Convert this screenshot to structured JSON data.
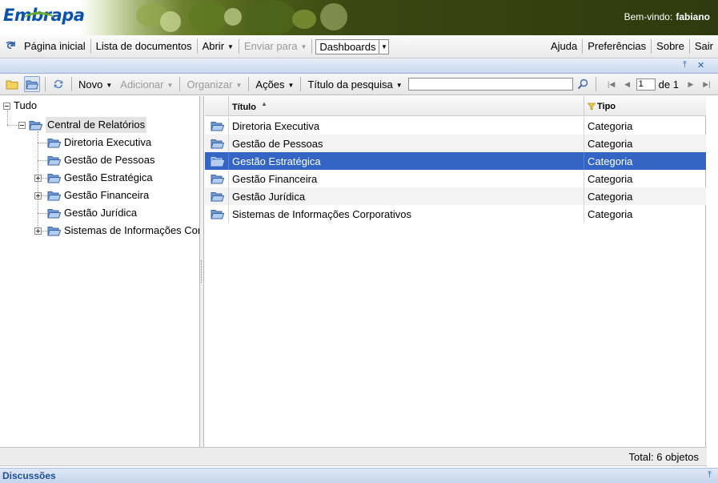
{
  "header": {
    "logo_text": "Embrapa",
    "welcome_label": "Bem-vindo:",
    "username": "fabiano"
  },
  "nav": {
    "home": "Página inicial",
    "documents": "Lista de documentos",
    "open": "Abrir",
    "send_to": "Enviar para",
    "dashboards": "Dashboards",
    "help": "Ajuda",
    "preferences": "Preferências",
    "about": "Sobre",
    "logout": "Sair"
  },
  "toolbar": {
    "new": "Novo",
    "add": "Adicionar",
    "organize": "Organizar",
    "actions": "Ações",
    "search_field": "Título da pesquisa",
    "search_value": "",
    "page_current": "1",
    "page_of": "de 1"
  },
  "tree": {
    "root": "Tudo",
    "central": "Central de Relatórios",
    "items": [
      {
        "label": "Diretoria Executiva",
        "expandable": false
      },
      {
        "label": "Gestão de Pessoas",
        "expandable": false
      },
      {
        "label": "Gestão Estratégica",
        "expandable": true
      },
      {
        "label": "Gestão Financeira",
        "expandable": true
      },
      {
        "label": "Gestão Jurídica",
        "expandable": false
      },
      {
        "label": "Sistemas de Informações Corporativos",
        "expandable": true
      }
    ]
  },
  "grid": {
    "col_title": "Título",
    "col_type": "Tipo",
    "rows": [
      {
        "title": "Diretoria Executiva",
        "type": "Categoria"
      },
      {
        "title": "Gestão de Pessoas",
        "type": "Categoria"
      },
      {
        "title": "Gestão Estratégica",
        "type": "Categoria"
      },
      {
        "title": "Gestão Financeira",
        "type": "Categoria"
      },
      {
        "title": "Gestão Jurídica",
        "type": "Categoria"
      },
      {
        "title": "Sistemas de Informações Corporativos",
        "type": "Categoria"
      }
    ],
    "selected_index": 2
  },
  "status": {
    "total": "Total: 6 objetos"
  },
  "discussions": {
    "title": "Discussões"
  },
  "colors": {
    "selection": "#3465c5",
    "logo_blue": "#0a54a8",
    "header_dark": "#3d4a14"
  }
}
